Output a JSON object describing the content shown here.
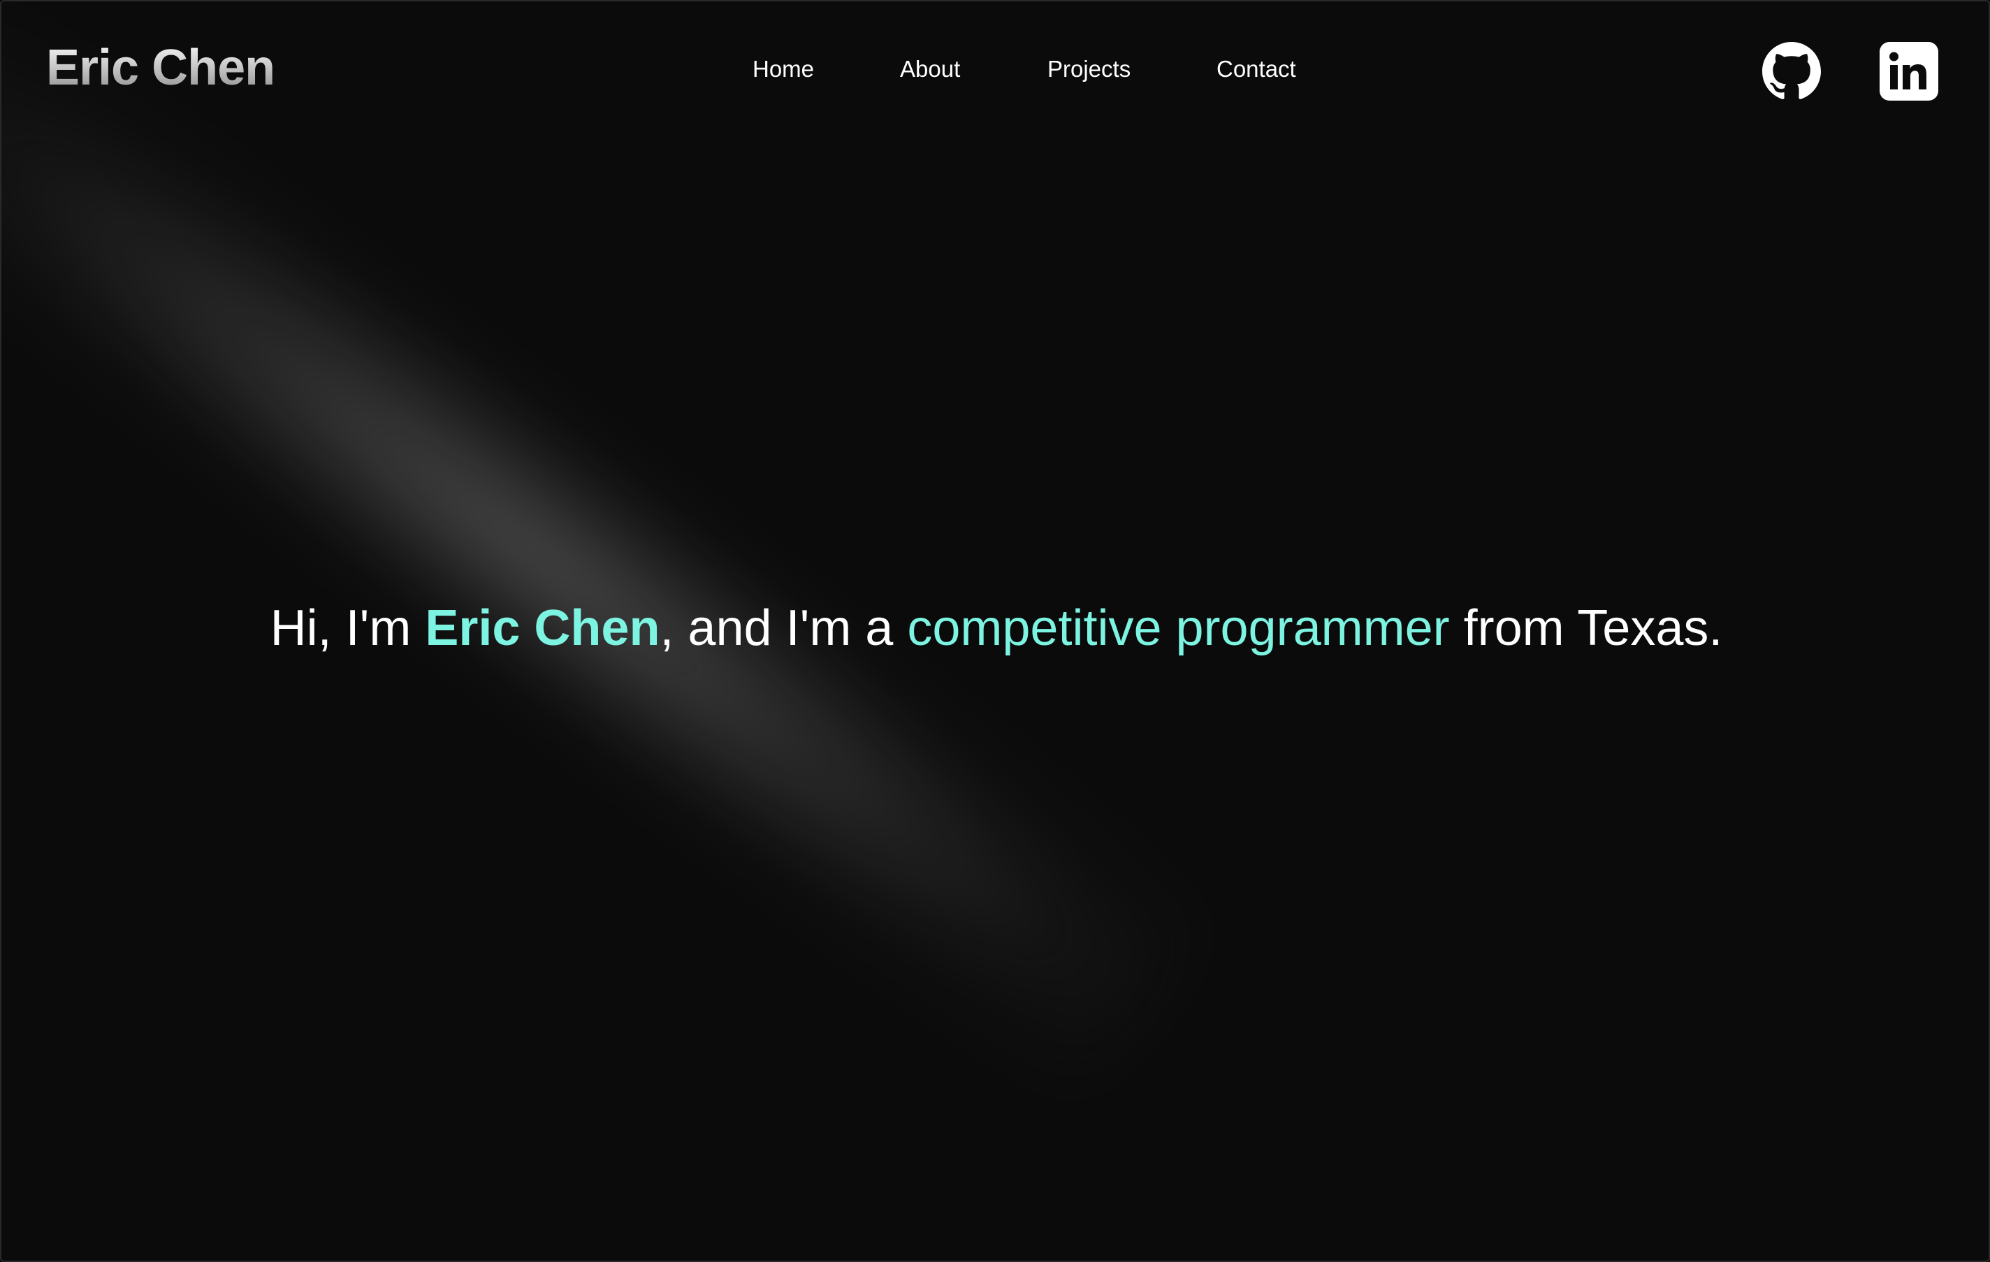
{
  "brand": {
    "name": "Eric Chen"
  },
  "nav": {
    "items": [
      {
        "label": "Home"
      },
      {
        "label": "About"
      },
      {
        "label": "Projects"
      },
      {
        "label": "Contact"
      }
    ]
  },
  "social": {
    "github_icon": "github-icon",
    "linkedin_icon": "linkedin-icon"
  },
  "hero": {
    "prefix": "Hi, I'm ",
    "name": "Eric Chen",
    "middle": ", and I'm a ",
    "role": "competitive programmer",
    "suffix": " from Texas."
  },
  "colors": {
    "background": "#0b0b0b",
    "accent": "#7df3e1",
    "text": "#ffffff"
  }
}
